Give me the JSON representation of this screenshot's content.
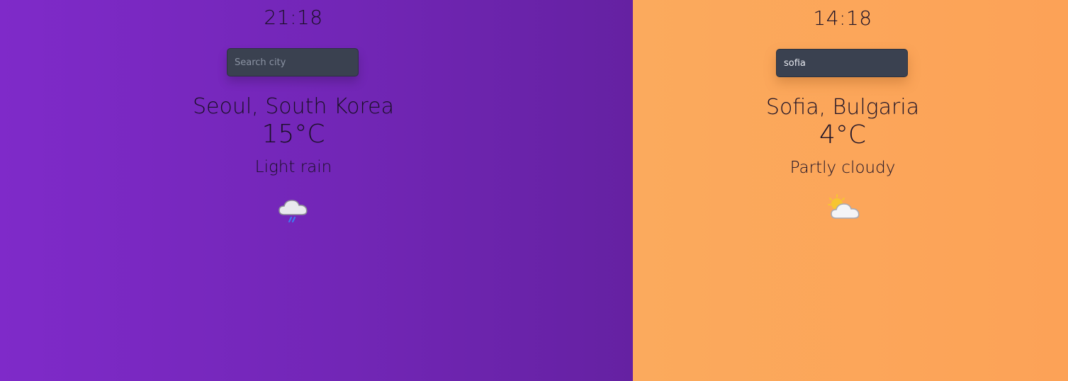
{
  "left_panel": {
    "time": "21:18",
    "search": {
      "placeholder": "Search city",
      "value": ""
    },
    "location": "Seoul, South Korea",
    "temperature": "15°C",
    "condition": "Light rain",
    "icon": "light-rain-icon",
    "background_color": "#7a29c1"
  },
  "right_panel": {
    "time": "14:18",
    "search": {
      "placeholder": "Search city",
      "value": "sofia"
    },
    "location": "Sofia, Bulgaria",
    "temperature": "4°C",
    "condition": "Partly cloudy",
    "icon": "partly-cloudy-icon",
    "background_color": "#fba65a"
  }
}
